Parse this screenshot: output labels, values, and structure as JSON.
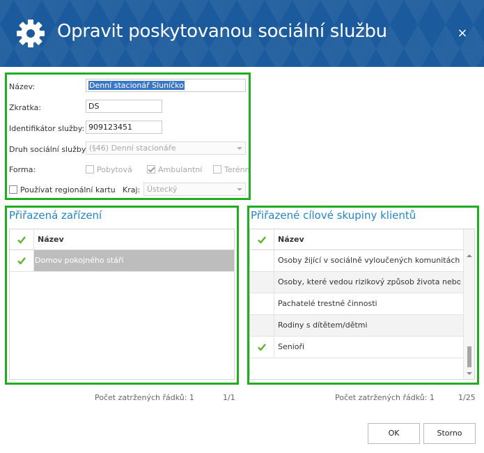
{
  "dialog": {
    "title": "Opravit poskytovanou sociální službu",
    "title_icon": "gear-icon",
    "close_label": "×"
  },
  "form": {
    "name_label": "Název:",
    "name_value": "Denní stacionář Sluníčko",
    "abbr_label": "Zkratka:",
    "abbr_value": "DS",
    "id_label": "Identifikátor služby:",
    "id_value": "909123451",
    "type_label": "Druh sociální služby:",
    "type_value": "(§46) Denní stacionáře",
    "form_label": "Forma:",
    "form_options": [
      {
        "label": "Pobytová",
        "checked": false
      },
      {
        "label": "Ambulantní",
        "checked": true
      },
      {
        "label": "Terénní",
        "checked": false
      }
    ],
    "regional_card_label": "Používat regionální kartu",
    "regional_card_checked": false,
    "region_label": "Kraj:",
    "region_value": "Ústecký"
  },
  "facilities": {
    "title": "Přiřazená zařízení",
    "column_header": "Název",
    "rows": [
      {
        "name": "Domov pokojného stáří",
        "checked": true,
        "selected": true
      }
    ],
    "footer_count_label": "Počet zatržených řádků: 1",
    "footer_page": "1/1"
  },
  "target_groups": {
    "title": "Přiřazené cílové skupiny klientů",
    "column_header": "Název",
    "rows": [
      {
        "name": "Osoby žijící v sociálně vyloučených komunitách",
        "checked": false
      },
      {
        "name": "Osoby, které vedou rizikový způsob života nebo jso...",
        "checked": false
      },
      {
        "name": "Pachatelé trestné činnosti",
        "checked": false
      },
      {
        "name": "Rodiny s dítětem/dětmi",
        "checked": false
      },
      {
        "name": "Senioři",
        "checked": true
      }
    ],
    "footer_count_label": "Počet zatržených řádků: 1",
    "footer_page": "1/25"
  },
  "buttons": {
    "ok_label": "OK",
    "cancel_label": "Storno"
  },
  "colors": {
    "titlebar": "#1b5a9c",
    "group_border": "#1fae1f",
    "section_title": "#2386c8",
    "check": "#5ab52a"
  }
}
